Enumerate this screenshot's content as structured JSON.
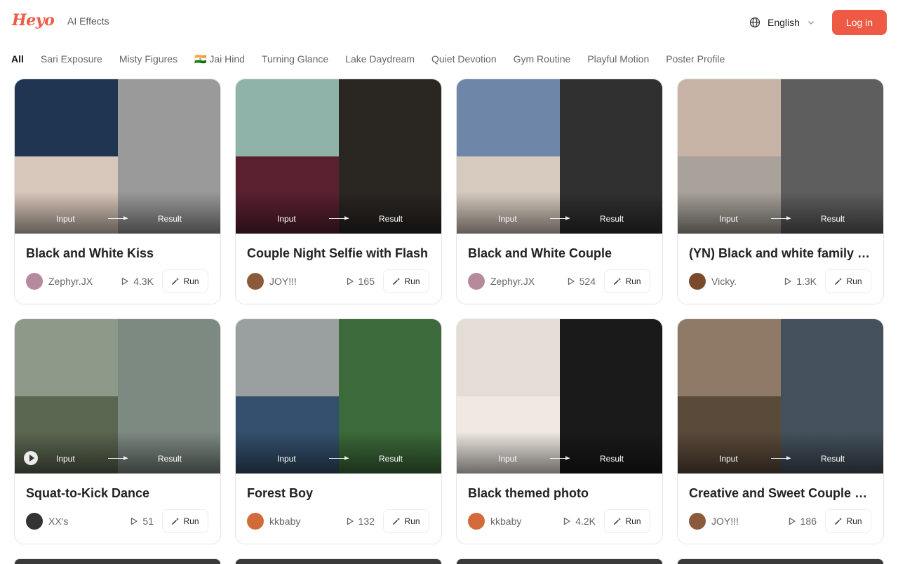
{
  "header": {
    "logo": "Heyo",
    "nav_link": "AI Effects",
    "language": "English",
    "login_label": "Log in",
    "accent_color": "#ef5a44"
  },
  "tabs": [
    {
      "label": "All",
      "active": true
    },
    {
      "label": "Sari Exposure"
    },
    {
      "label": "Misty Figures"
    },
    {
      "label": "🇮🇳 Jai Hind"
    },
    {
      "label": "Turning Glance"
    },
    {
      "label": "Lake Daydream"
    },
    {
      "label": "Quiet Devotion"
    },
    {
      "label": "Gym Routine"
    },
    {
      "label": "Playful Motion"
    },
    {
      "label": "Poster Profile"
    }
  ],
  "labels": {
    "input": "Input",
    "result": "Result",
    "run": "Run"
  },
  "icons": {
    "globe": "globe-icon",
    "chevron": "chevron-down-icon",
    "play": "play-icon",
    "wand": "magic-wand-icon"
  },
  "cards": [
    {
      "title": "Black and White Kiss",
      "author": "Zephyr.JX",
      "views": "4.3K",
      "colors": {
        "q1": "#1f3552",
        "q2": "#d8c7bb",
        "right": "#9a9a9a",
        "avatar": "#b58a9c"
      }
    },
    {
      "title": "Couple Night Selfie with Flash",
      "author": "JOY!!!",
      "views": "165",
      "colors": {
        "q1": "#8fb3a8",
        "q2": "#5a2030",
        "right": "#2a2622",
        "avatar": "#8a5a3a"
      }
    },
    {
      "title": "Black and White Couple",
      "author": "Zephyr.JX",
      "views": "524",
      "colors": {
        "q1": "#6e86a8",
        "q2": "#d7cbbf",
        "right": "#303030",
        "avatar": "#b58a9c"
      }
    },
    {
      "title": "(YN) Black and white family …",
      "author": "Vicky.",
      "views": "1.3K",
      "colors": {
        "q1": "#c7b4a6",
        "q2": "#a8a29a",
        "right": "#5e5e5e",
        "avatar": "#7a4a2a"
      }
    },
    {
      "title": "Squat-to-Kick Dance",
      "author": "XX's",
      "views": "51",
      "video": true,
      "colors": {
        "q1": "#8d9a8a",
        "q2": "#5b6650",
        "right": "#7d8a82",
        "avatar": "#333333"
      }
    },
    {
      "title": "Forest Boy",
      "author": "kkbaby",
      "views": "132",
      "colors": {
        "q1": "#9aa0a0",
        "q2": "#34506e",
        "right": "#3c6a3a",
        "avatar": "#d26a3a"
      }
    },
    {
      "title": "Black themed photo",
      "author": "kkbaby",
      "views": "4.2K",
      "colors": {
        "q1": "#e3ddd6",
        "q2": "#efe9e2",
        "right": "#1a1a1a",
        "avatar": "#d26a3a"
      }
    },
    {
      "title": "Creative and Sweet Couple …",
      "author": "JOY!!!",
      "views": "186",
      "colors": {
        "q1": "#8e7a66",
        "q2": "#5a4a3a",
        "right": "#44505c",
        "avatar": "#8a5a3a"
      }
    }
  ]
}
